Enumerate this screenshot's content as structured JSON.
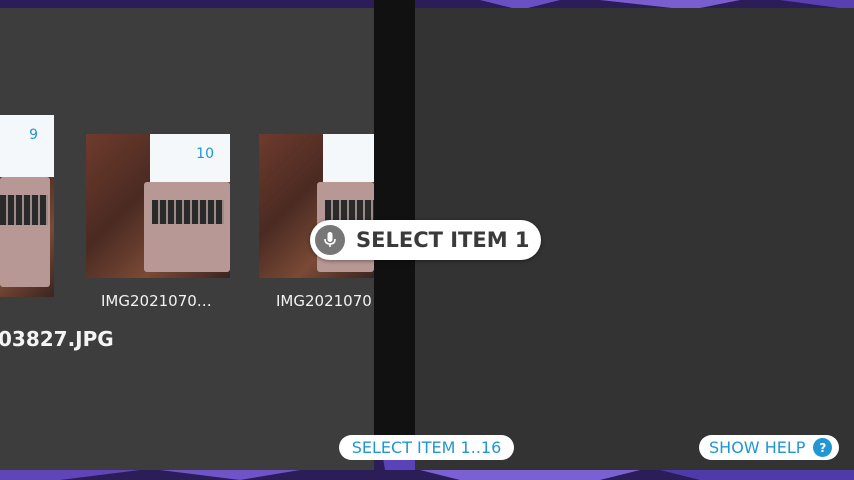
{
  "gallery": {
    "items": [
      {
        "number": "9",
        "caption": ""
      },
      {
        "number": "10",
        "caption": "IMG2021070…"
      },
      {
        "number": "",
        "caption": "IMG2021070"
      }
    ],
    "selected_file": "03827.JPG"
  },
  "voice_overlay": {
    "icon": "microphone-icon",
    "command": "SELECT ITEM 1"
  },
  "bottom_bar": {
    "select_range_label": "SELECT ITEM 1..16",
    "help_label": "SHOW HELP",
    "help_badge": "?"
  },
  "colors": {
    "accent": "#2196d3",
    "panel_left": "#3d3d3d",
    "panel_right": "#333333",
    "wallpaper": "#2a1d58"
  }
}
